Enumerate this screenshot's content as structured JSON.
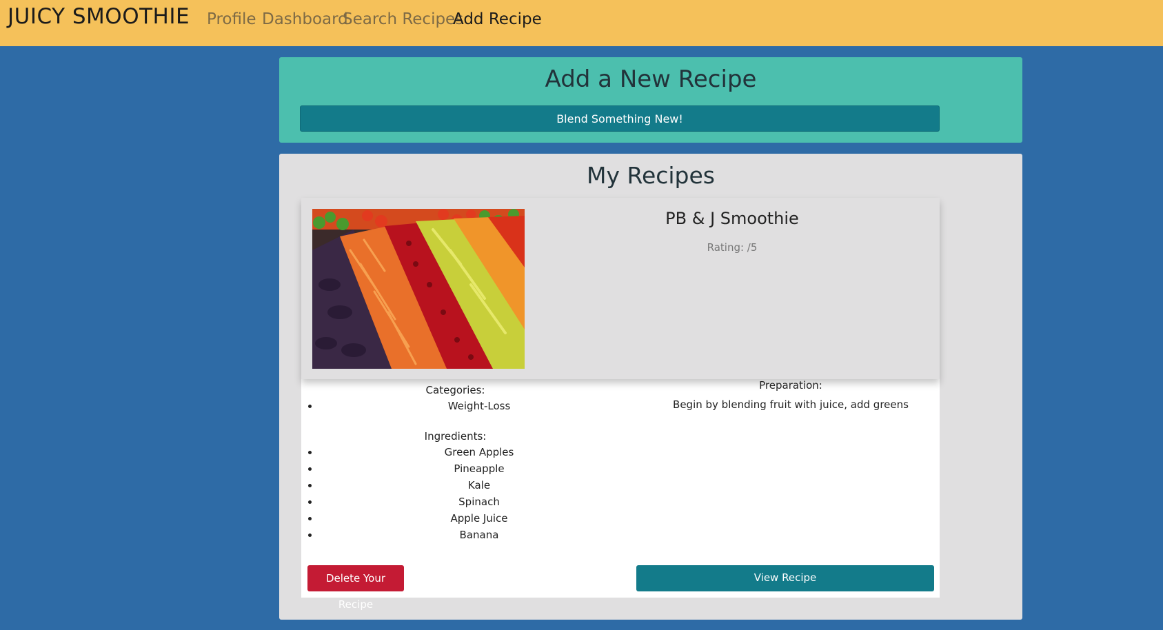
{
  "nav": {
    "brand": "JUICY SMOOTHIE",
    "links": [
      {
        "label": "Profile",
        "active": false
      },
      {
        "label": "Dashboard",
        "active": false
      },
      {
        "label": "Search Recipes",
        "active": false
      },
      {
        "label": "Add Recipe",
        "active": true
      }
    ]
  },
  "add_panel": {
    "title": "Add a New Recipe",
    "button_label": "Blend Something New!"
  },
  "recipes_panel": {
    "title": "My Recipes",
    "recipe": {
      "title": "PB & J Smoothie",
      "rating_text": "Rating: /5",
      "categories_label": "Categories:",
      "categories": [
        "Weight-Loss"
      ],
      "ingredients_label": "Ingredients:",
      "ingredients": [
        "Green Apples",
        "Pineapple",
        "Kale",
        "Spinach",
        "Apple Juice",
        "Banana"
      ],
      "preparation_label": "Preparation:",
      "preparation": "Begin by blending fruit with juice, add greens",
      "delete_label": "Delete Your Recipe",
      "view_label": "View Recipe"
    }
  },
  "colors": {
    "navbar": "#f5c15a",
    "page_background": "#2e6ba6",
    "add_panel": "#4cbfae",
    "teal_button": "#137b8a",
    "delete_button": "#c41b34",
    "panel_grey": "#e0dfe0"
  }
}
